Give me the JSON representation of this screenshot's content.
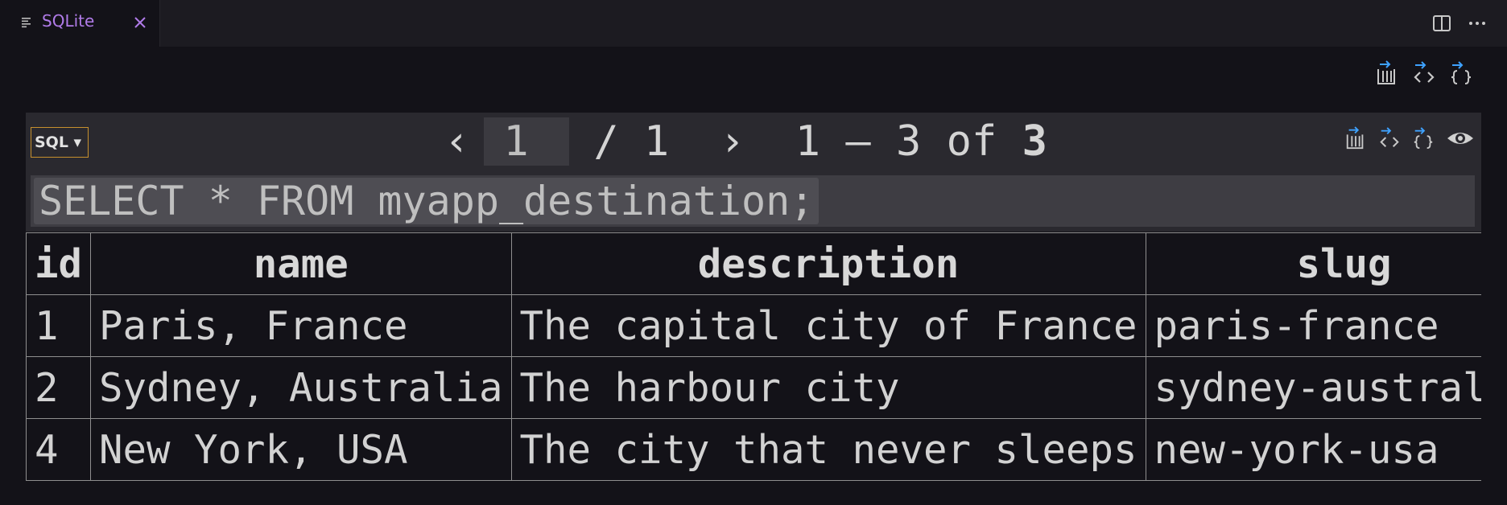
{
  "tab": {
    "label": "SQLite",
    "icon": "list-icon",
    "close_icon": "close-icon",
    "accent": "#b07be8"
  },
  "window_actions": {
    "split_icon": "split-editor-icon",
    "more_icon": "more-icon"
  },
  "toolbar": {
    "export_icon": "export-icon",
    "code_icon": "code-icon",
    "json_icon": "json-icon"
  },
  "query_panel": {
    "language": "SQL ▾",
    "pager": {
      "prev": "‹",
      "page": "1",
      "of_pages": "/ 1",
      "next": "›",
      "range": "1 – 3 of",
      "total": "3"
    },
    "eye_icon": "eye-icon",
    "query": "SELECT * FROM myapp_destination;"
  },
  "results": {
    "columns": [
      "id",
      "name",
      "description",
      "slug"
    ],
    "rows": [
      [
        "1",
        "Paris, France",
        "The capital city of France",
        "paris-france"
      ],
      [
        "2",
        "Sydney, Australia",
        "The harbour city",
        "sydney-australia"
      ],
      [
        "4",
        "New York, USA",
        "The city that never sleeps",
        "new-york-usa"
      ]
    ]
  }
}
